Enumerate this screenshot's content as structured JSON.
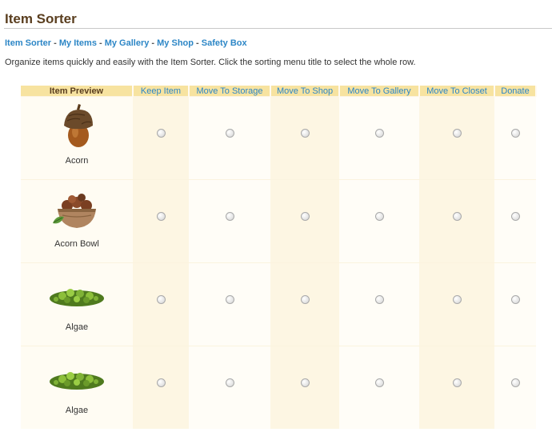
{
  "page": {
    "title": "Item Sorter"
  },
  "nav": {
    "links": [
      "Item Sorter",
      "My Items",
      "My Gallery",
      "My Shop",
      "Safety Box"
    ],
    "separator": " - "
  },
  "intro": "Organize items quickly and easily with the Item Sorter. Click the sorting menu title to select the whole row.",
  "table": {
    "headers": [
      "Item Preview",
      "Keep Item",
      "Move To Storage",
      "Move To Shop",
      "Move To Gallery",
      "Move To Closet",
      "Donate"
    ],
    "items": [
      {
        "name": "Acorn",
        "icon": "acorn-icon"
      },
      {
        "name": "Acorn Bowl",
        "icon": "acorn-bowl-icon"
      },
      {
        "name": "Algae",
        "icon": "algae-icon"
      },
      {
        "name": "Algae",
        "icon": "algae-icon"
      }
    ]
  },
  "colors": {
    "link": "#2c86c6",
    "title": "#5a3e1f",
    "header_bg": "#f7e3a0"
  }
}
